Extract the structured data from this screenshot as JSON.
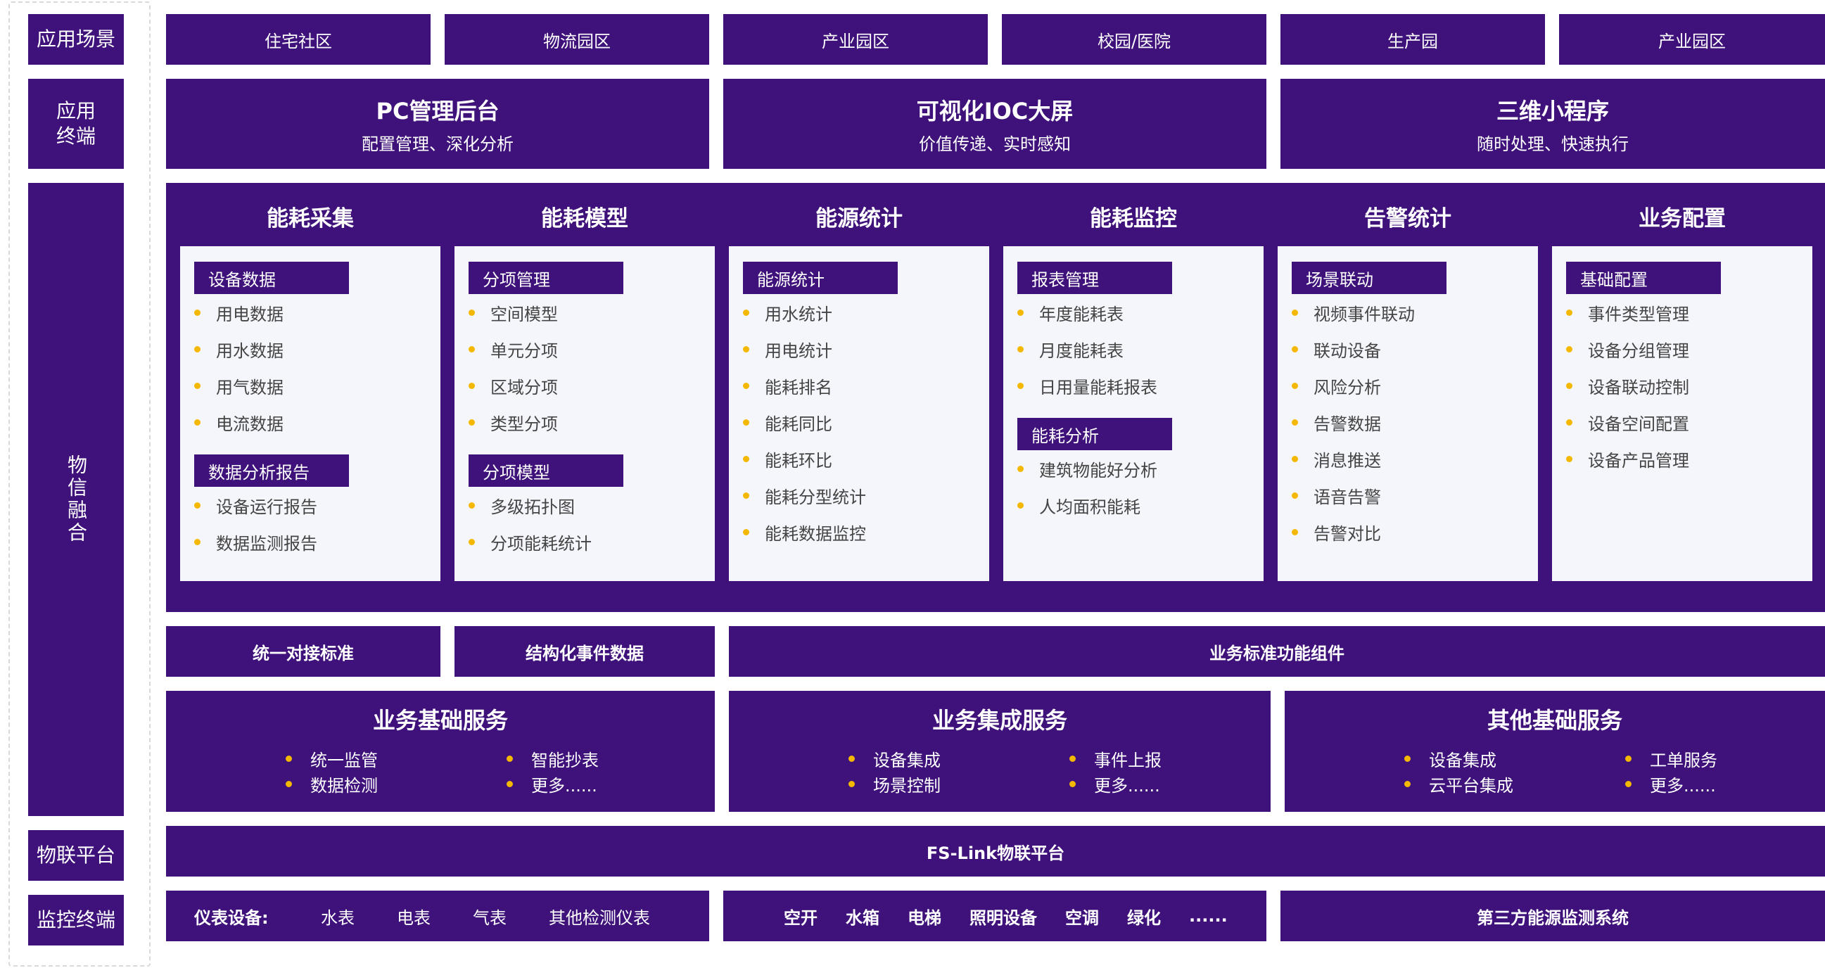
{
  "left_column": {
    "scenarios_label": "应用场景",
    "terminals_label": "应用\n终端",
    "fusion_label": "物信融合",
    "iot_platform_label": "物联平台",
    "monitor_label": "监控终端"
  },
  "scenarios": [
    "住宅社区",
    "物流园区",
    "产业园区",
    "校园/医院",
    "生产园",
    "产业园区"
  ],
  "terminals": [
    {
      "title": "PC管理后台",
      "subtitle": "配置管理、深化分析"
    },
    {
      "title": "可视化IOC大屏",
      "subtitle": "价值传递、实时感知"
    },
    {
      "title": "三维小程序",
      "subtitle": "随时处理、快速执行"
    }
  ],
  "modules": [
    {
      "title": "能耗采集",
      "groups": [
        {
          "label": "设备数据",
          "items": [
            "用电数据",
            "用水数据",
            "用气数据",
            "电流数据"
          ]
        },
        {
          "label": "数据分析报告",
          "items": [
            "设备运行报告",
            "数据监测报告"
          ]
        }
      ]
    },
    {
      "title": "能耗模型",
      "groups": [
        {
          "label": "分项管理",
          "items": [
            "空间模型",
            "单元分项",
            "区域分项",
            "类型分项"
          ]
        },
        {
          "label": "分项模型",
          "items": [
            "多级拓扑图",
            "分项能耗统计"
          ]
        }
      ]
    },
    {
      "title": "能源统计",
      "groups": [
        {
          "label": "能源统计",
          "items": [
            "用水统计",
            "用电统计",
            "能耗排名",
            "能耗同比",
            "能耗环比",
            "能耗分型统计",
            "能耗数据监控"
          ]
        }
      ]
    },
    {
      "title": "能耗监控",
      "groups": [
        {
          "label": "报表管理",
          "items": [
            "年度能耗表",
            "月度能耗表",
            "日用量能耗报表"
          ]
        },
        {
          "label": "能耗分析",
          "items": [
            "建筑物能好分析",
            "人均面积能耗"
          ]
        }
      ]
    },
    {
      "title": "告警统计",
      "groups": [
        {
          "label": "场景联动",
          "items": [
            "视频事件联动",
            "联动设备",
            "风险分析",
            "告警数据",
            "消息推送",
            "语音告警",
            "告警对比"
          ]
        }
      ]
    },
    {
      "title": "业务配置",
      "groups": [
        {
          "label": "基础配置",
          "items": [
            "事件类型管理",
            "设备分组管理",
            "设备联动控制",
            "设备空间配置",
            "设备产品管理"
          ]
        }
      ]
    }
  ],
  "standards": [
    "统一对接标准",
    "结构化事件数据",
    "业务标准功能组件"
  ],
  "services": [
    {
      "title": "业务基础服务",
      "items": [
        "统一监管",
        "智能抄表",
        "数据检测",
        "更多......"
      ]
    },
    {
      "title": "业务集成服务",
      "items": [
        "设备集成",
        "事件上报",
        "场景控制",
        "更多......"
      ]
    },
    {
      "title": "其他基础服务",
      "items": [
        "设备集成",
        "工单服务",
        "云平台集成",
        "更多......"
      ]
    }
  ],
  "iot_platform": "FS-Link物联平台",
  "monitoring": {
    "meters_label": "仪表设备:",
    "meters": [
      "水表",
      "电表",
      "气表",
      "其他检测仪表"
    ],
    "devices": [
      "空开",
      "水箱",
      "电梯",
      "照明设备",
      "空调",
      "绿化",
      "......"
    ],
    "third_party": "第三方能源监测系统"
  },
  "colors": {
    "primary": "#3f117a",
    "bullet": "#f5b800",
    "card": "#f5f6fb"
  }
}
